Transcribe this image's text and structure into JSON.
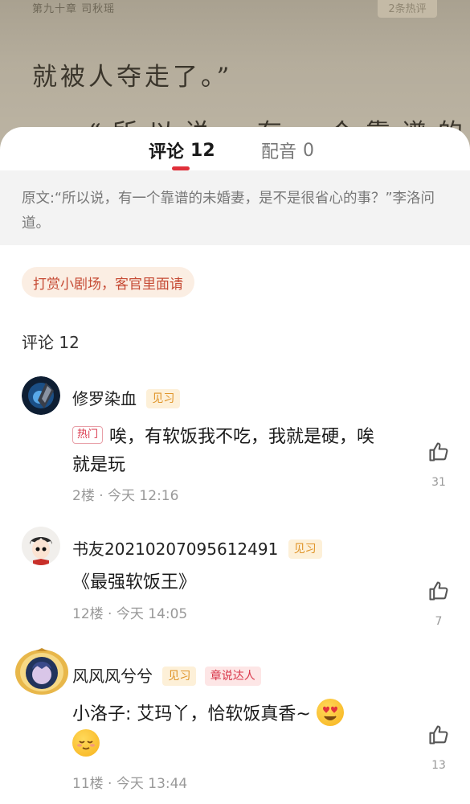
{
  "book": {
    "chapter": "第九十章 司秋瑶",
    "hot_comments_badge": "2条热评",
    "line1": "就被人夺走了。”",
    "line2": "“所以说，有一个靠谱的未婚"
  },
  "tabs": [
    {
      "label": "评论",
      "count": "12",
      "active": true
    },
    {
      "label": "配音",
      "count": "0",
      "active": false
    }
  ],
  "quote": {
    "text": "原文:“所以说，有一个靠谱的未婚妻，是不是很省心的事？”李洛问道。"
  },
  "reward_pill": "打赏小剧场，客官里面请",
  "section_title": "评论 12",
  "comments": [
    {
      "username": "修罗染血",
      "badges": [
        "见习"
      ],
      "hot_tag": "热门",
      "text": "唉，有软饭我不吃，我就是硬，唉就是玩",
      "meta": "2楼 · 今天 12:16",
      "likes": "31"
    },
    {
      "username": "书友20210207095612491",
      "badges": [
        "见习"
      ],
      "text": "《最强软饭王》",
      "meta": "12楼 · 今天 14:05",
      "likes": "7"
    },
    {
      "username": "风风风兮兮",
      "badges": [
        "见习",
        "章说达人"
      ],
      "text": "小洛子: 艾玛丫，恰软饭真香~",
      "meta": "11楼 · 今天 13:44",
      "likes": "13"
    }
  ],
  "colors": {
    "accent": "#e0303a",
    "level_badge": "#e0952a",
    "talent_badge": "#d9364a"
  }
}
